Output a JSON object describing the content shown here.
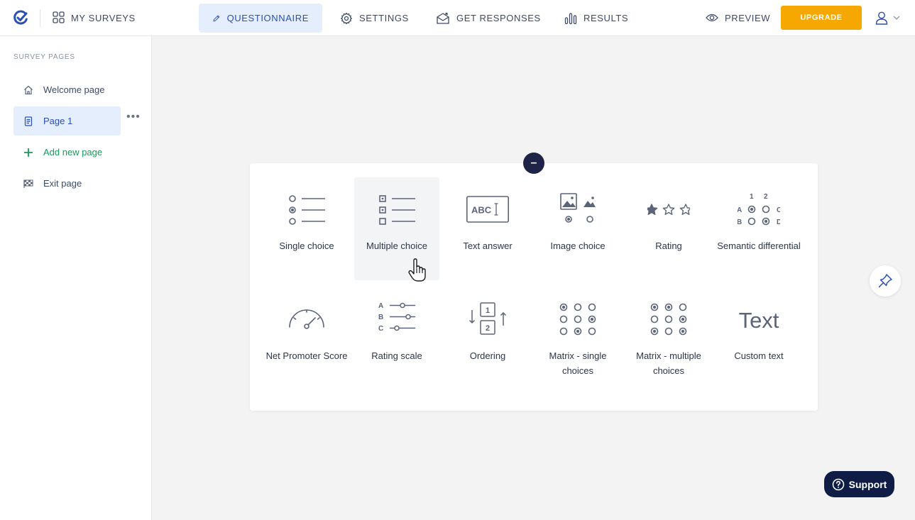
{
  "topbar": {
    "my_surveys": "MY SURVEYS",
    "tabs": [
      {
        "label": "QUESTIONNAIRE",
        "icon": "pencil-icon"
      },
      {
        "label": "SETTINGS",
        "icon": "gear-icon"
      },
      {
        "label": "GET RESPONSES",
        "icon": "envelope-icon"
      },
      {
        "label": "RESULTS",
        "icon": "bar-chart-icon"
      }
    ],
    "preview": "PREVIEW",
    "upgrade": "UPGRADE"
  },
  "sidebar": {
    "heading": "SURVEY PAGES",
    "items": [
      {
        "label": "Welcome page",
        "icon": "home-icon"
      },
      {
        "label": "Page 1",
        "icon": "document-icon"
      },
      {
        "label": "Add new page",
        "icon": "plus-icon"
      },
      {
        "label": "Exit page",
        "icon": "checkered-flag-icon"
      }
    ],
    "more": "•••"
  },
  "question_types": [
    {
      "label": "Single choice"
    },
    {
      "label": "Multiple choice"
    },
    {
      "label": "Text answer",
      "glyph": "ABC"
    },
    {
      "label": "Image choice"
    },
    {
      "label": "Rating"
    },
    {
      "label": "Semantic differential",
      "glyphs": [
        "1",
        "2",
        "A",
        "C",
        "B",
        "D"
      ]
    },
    {
      "label": "Net Promoter Score"
    },
    {
      "label": "Rating scale",
      "glyphs": [
        "A",
        "B",
        "C"
      ]
    },
    {
      "label": "Ordering",
      "glyphs": [
        "1",
        "2"
      ]
    },
    {
      "label": "Matrix - single choices"
    },
    {
      "label": "Matrix - multiple choices"
    },
    {
      "label": "Custom text",
      "glyph": "Text"
    }
  ],
  "collapse": "–",
  "support": "Support",
  "colors": {
    "accent": "#2a4fb5",
    "upgrade": "#f6a800",
    "support": "#0f1d46",
    "add": "#1b9a5b",
    "icon": "#5c6479"
  }
}
